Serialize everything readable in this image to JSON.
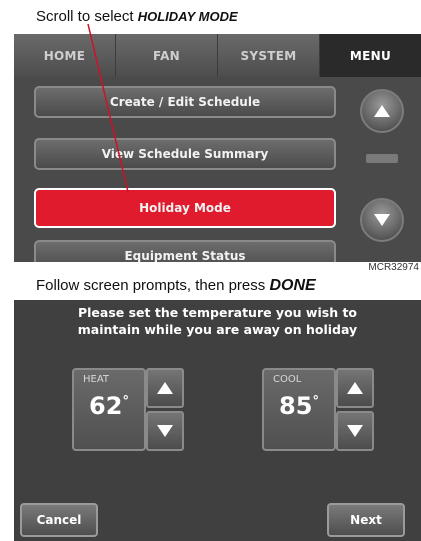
{
  "captions": {
    "select_prefix": "Scroll to select ",
    "select_em": "HOLIDAY MODE",
    "follow_prefix": "Follow screen prompts, then press ",
    "follow_em": "DONE",
    "figure_code": "MCR32974"
  },
  "menu_screen": {
    "tabs": [
      {
        "label": "HOME"
      },
      {
        "label": "FAN"
      },
      {
        "label": "SYSTEM"
      },
      {
        "label": "MENU",
        "active": true
      }
    ],
    "items": [
      {
        "label": "Create / Edit Schedule"
      },
      {
        "label": "View Schedule Summary"
      },
      {
        "label": "Holiday Mode",
        "selected": true
      },
      {
        "label": "Equipment Status"
      }
    ],
    "scroll_up_icon": "up-arrow-icon",
    "scroll_down_icon": "down-arrow-icon"
  },
  "holiday_screen": {
    "prompt_line1": "Please set the temperature you wish to",
    "prompt_line2": "maintain while you are away on holiday",
    "heat": {
      "label": "HEAT",
      "value": "62",
      "unit": "°"
    },
    "cool": {
      "label": "COOL",
      "value": "85",
      "unit": "°"
    },
    "cancel_label": "Cancel",
    "next_label": "Next"
  },
  "colors": {
    "selected_item": "#e01b2e",
    "pointer_line": "#d0102a",
    "panel_bg": "#4a4a4a"
  }
}
